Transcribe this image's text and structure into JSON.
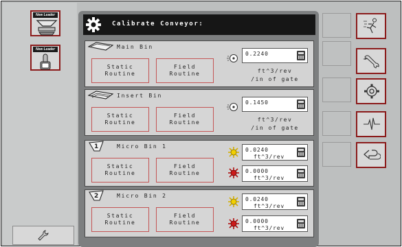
{
  "header": {
    "title": "Calibrate Conveyor:",
    "gear_icon": "gear-icon"
  },
  "left_tabs": [
    {
      "brand": "New Leader",
      "icon": "spreader-icon"
    },
    {
      "brand": "New Leader",
      "icon": "joystick-icon"
    }
  ],
  "left_footer": {
    "icon": "wrench-icon"
  },
  "bins": [
    {
      "name": "Main Bin",
      "static_label_1": "Static",
      "static_label_2": "Routine",
      "field_label_1": "Field",
      "field_label_2": "Routine",
      "indicator_icon": "speed-gauge-icon",
      "value": "0.2240",
      "unit_line_1": "ft^3/rev",
      "unit_line_2": "/in of gate"
    },
    {
      "name": "Insert Bin",
      "static_label_1": "Static",
      "static_label_2": "Routine",
      "field_label_1": "Field",
      "field_label_2": "Routine",
      "indicator_icon": "speed-gauge-icon",
      "value": "0.1450",
      "unit_line_1": "ft^3/rev",
      "unit_line_2": "/in of gate"
    },
    {
      "name": "Micro Bin 1",
      "static_label_1": "Static",
      "static_label_2": "Routine",
      "field_label_1": "Field",
      "field_label_2": "Routine",
      "values": [
        {
          "indicator_icon": "yellow-spinner-icon",
          "value": "0.0240",
          "unit": "ft^3/rev"
        },
        {
          "indicator_icon": "red-spinner-icon",
          "value": "0.0000",
          "unit": "ft^3/rev"
        }
      ]
    },
    {
      "name": "Micro Bin 2",
      "static_label_1": "Static",
      "static_label_2": "Routine",
      "field_label_1": "Field",
      "field_label_2": "Routine",
      "values": [
        {
          "indicator_icon": "yellow-spinner-icon",
          "value": "0.0240",
          "unit": "ft^3/rev"
        },
        {
          "indicator_icon": "red-spinner-icon",
          "value": "0.0000",
          "unit": "ft^3/rev"
        }
      ]
    }
  ],
  "right_buttons": [
    {
      "icon": "operator-run-icon"
    },
    {
      "icon": "wrench-icon"
    },
    {
      "icon": "gear-icon"
    },
    {
      "icon": "pulse-waveform-icon"
    },
    {
      "icon": "back-arrow-icon"
    }
  ],
  "colors": {
    "accent_border": "#8b1a1a",
    "routine_border": "#c45454",
    "title_bar": "#161616",
    "panel_bg": "#7d7f80"
  }
}
